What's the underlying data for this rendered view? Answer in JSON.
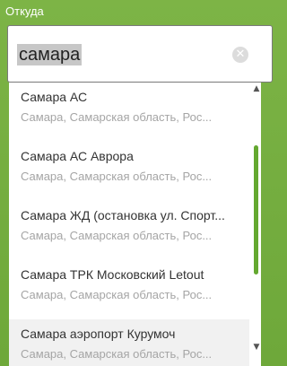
{
  "field_label": "Откуда",
  "search": {
    "value": "самара",
    "clear_icon": "clear-icon"
  },
  "results": [
    {
      "name": "Самара АС",
      "region": "Самара, Самарская область, Рос..."
    },
    {
      "name": "Самара АС Аврора",
      "region": "Самара, Самарская область, Рос..."
    },
    {
      "name": "Самара ЖД (остановка ул. Спорт...",
      "region": "Самара, Самарская область, Рос..."
    },
    {
      "name": "Самара ТРК Московский Letout",
      "region": "Самара, Самарская область, Рос..."
    },
    {
      "name": "Самара аэропорт Курумоч",
      "region": "Самара, Самарская область, Рос..."
    }
  ],
  "scrollbar": {
    "up_icon": "▲",
    "down_icon": "▼"
  },
  "colors": {
    "background": "#76ae40",
    "accent": "#64a830",
    "highlight": "#f1f1f1"
  }
}
